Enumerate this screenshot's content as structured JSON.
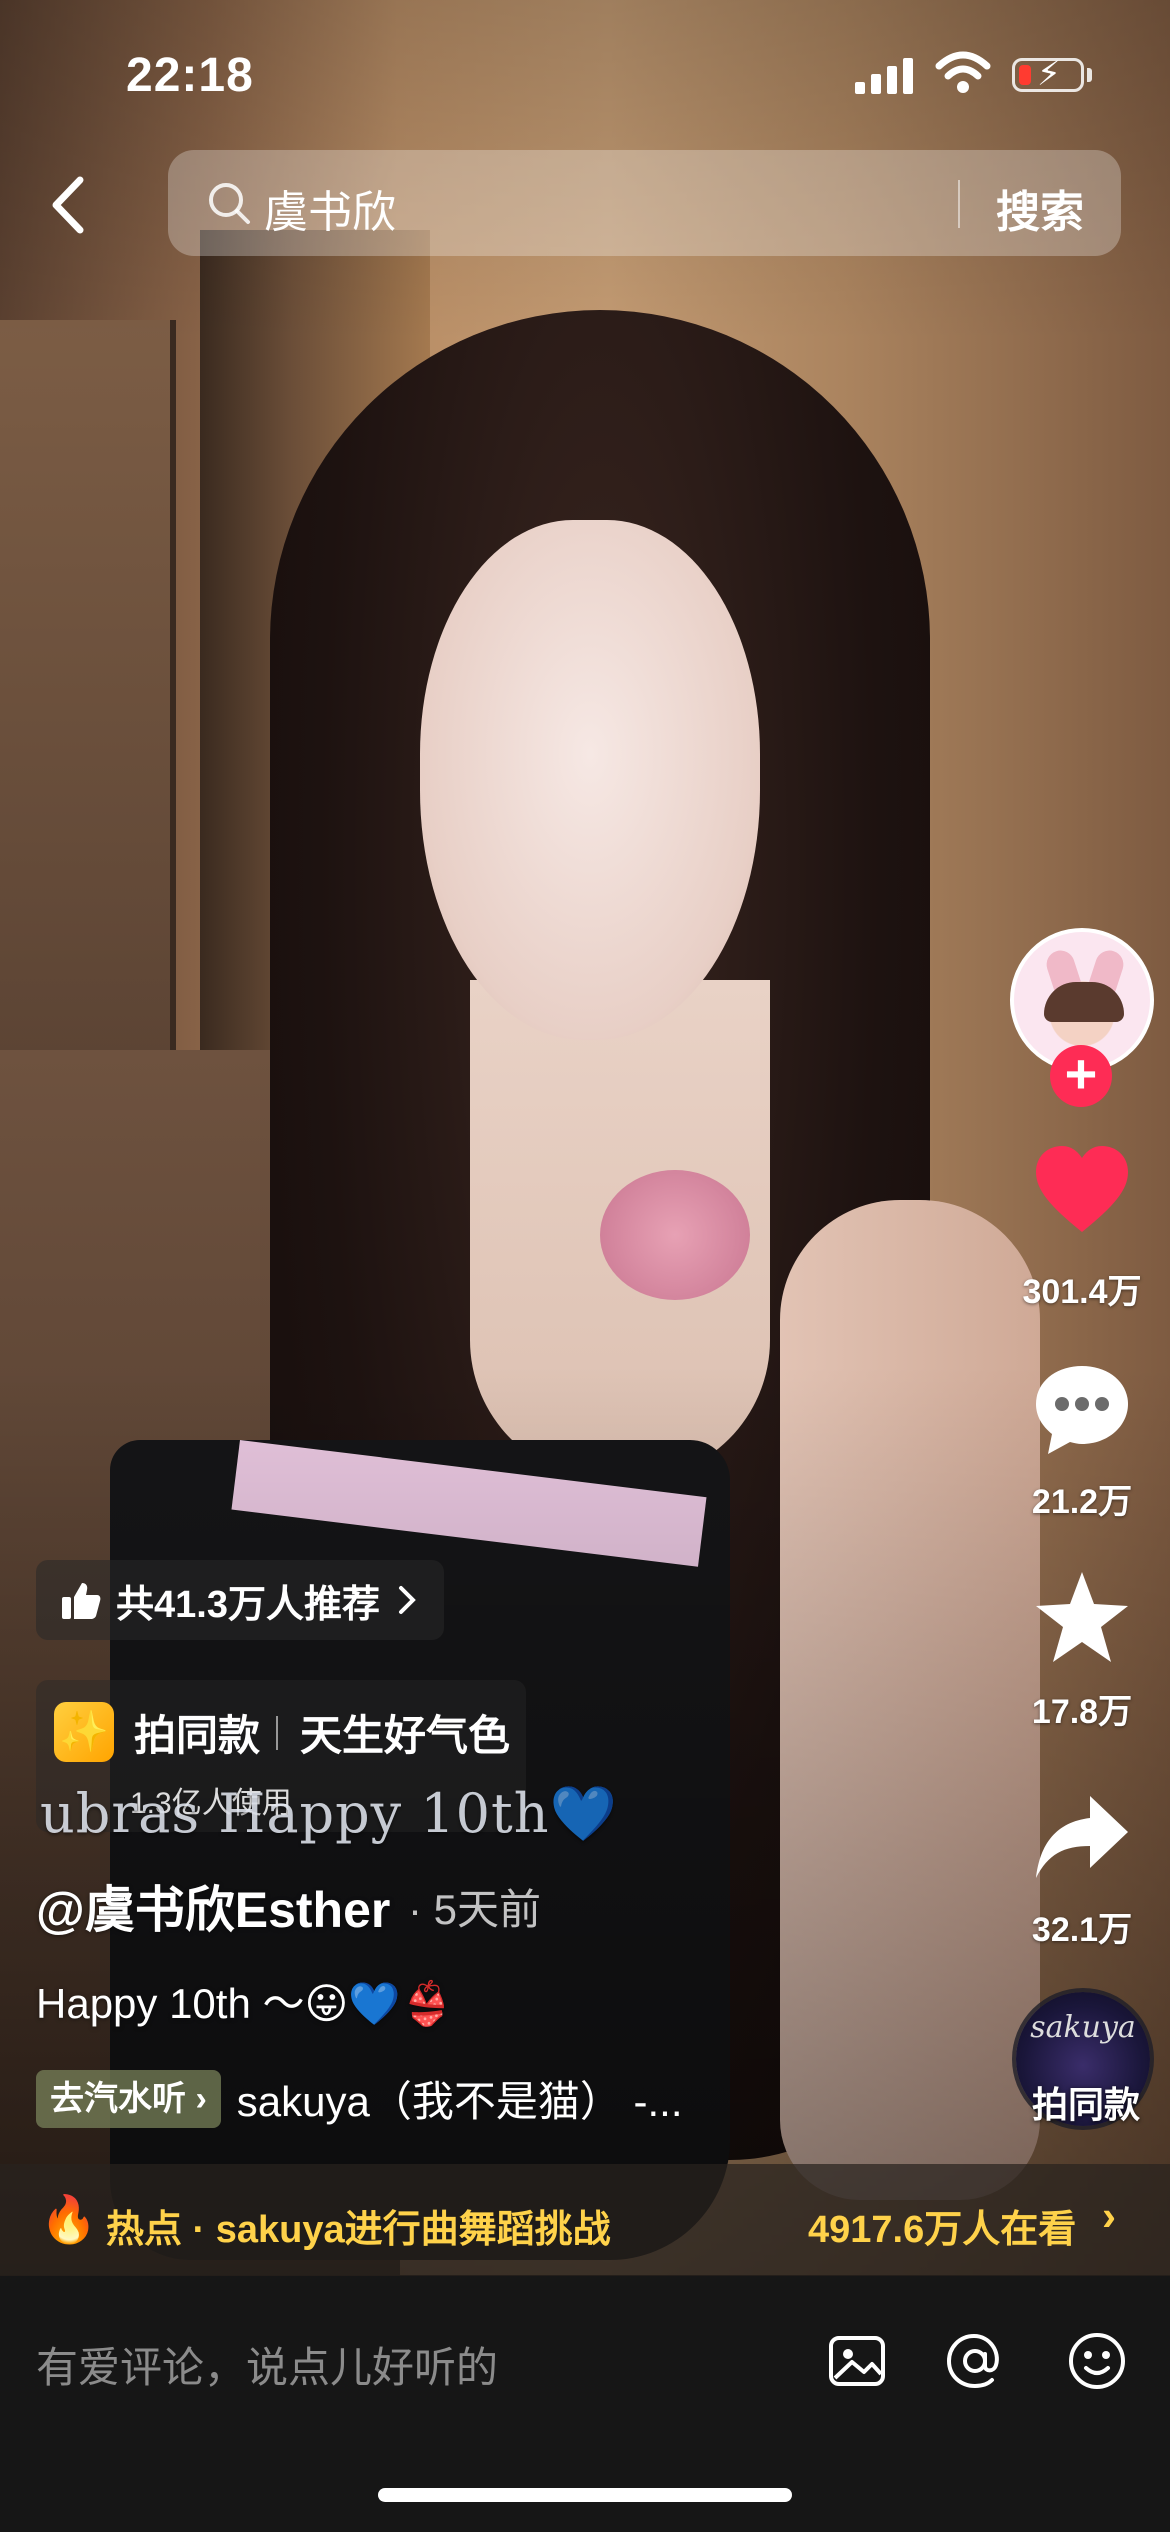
{
  "status_bar": {
    "time": "22:18"
  },
  "search": {
    "query": "虞书欣",
    "button": "搜索"
  },
  "rail": {
    "likes": "301.4万",
    "comments": "21.2万",
    "favorites": "17.8万",
    "shares": "32.1万",
    "music_disc_brand": "sakuya",
    "music_disc_label": "拍同款"
  },
  "recommend": {
    "label": "共41.3万人推荐"
  },
  "template": {
    "action": "拍同款",
    "name": "天生好气色",
    "users": "1.3亿人使用"
  },
  "video_overlay_text": "ubras Happy 10th💙",
  "post": {
    "author": "@虞书欣Esther",
    "posted": "· 5天前",
    "caption": "Happy 10th ～😛💙👙",
    "music_chip": "去汽水听",
    "music_title": "sakuya（我不是猫） -..."
  },
  "hot": {
    "topic": "热点 · sakuya进行曲舞蹈挑战",
    "watching": "4917.6万人在看"
  },
  "comment": {
    "placeholder": "有爱评论，说点儿好听的"
  },
  "colors": {
    "accent": "#fe2c55",
    "hot_text": "#ffd24a",
    "comment_bar_bg": "#161616"
  }
}
